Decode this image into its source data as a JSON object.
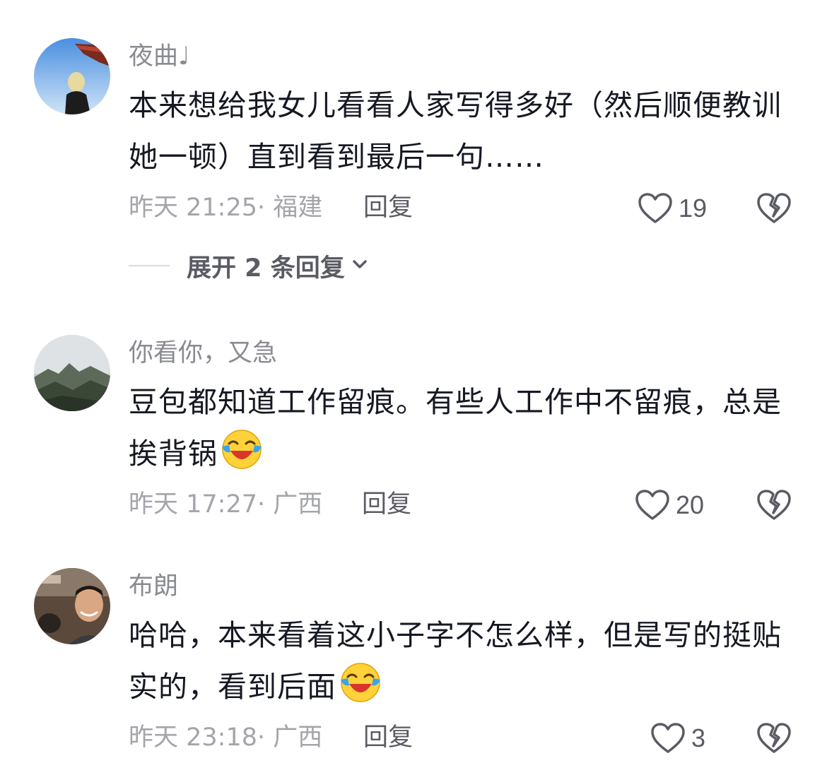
{
  "comments": [
    {
      "username": "夜曲♩",
      "text": "本来想给我女儿看看人家写得多好（然后顺便教训她一顿）直到看到最后一句……",
      "meta": "昨天 21:25· 福建",
      "reply_label": "回复",
      "likes": "19",
      "expand_label": "展开 2 条回复"
    },
    {
      "username": "你看你，又急",
      "text": "豆包都知道工作留痕。有些人工作中不留痕，总是挨背锅",
      "meta": "昨天 17:27· 广西",
      "reply_label": "回复",
      "likes": "20"
    },
    {
      "username": "布朗",
      "text": "哈哈，本来看着这小子字不怎么样，但是写的挺贴实的，看到后面",
      "meta": "昨天 23:18· 广西",
      "reply_label": "回复",
      "likes": "3"
    }
  ],
  "icons": {
    "like": "heart-outline-icon",
    "dislike": "broken-heart-icon",
    "expand": "chevron-down-icon",
    "emoji": "laughing-crying-emoji"
  },
  "colors": {
    "username": "#8a8b91",
    "meta": "#a4a5aa",
    "text": "#161823",
    "icon": "#5a5b63"
  }
}
